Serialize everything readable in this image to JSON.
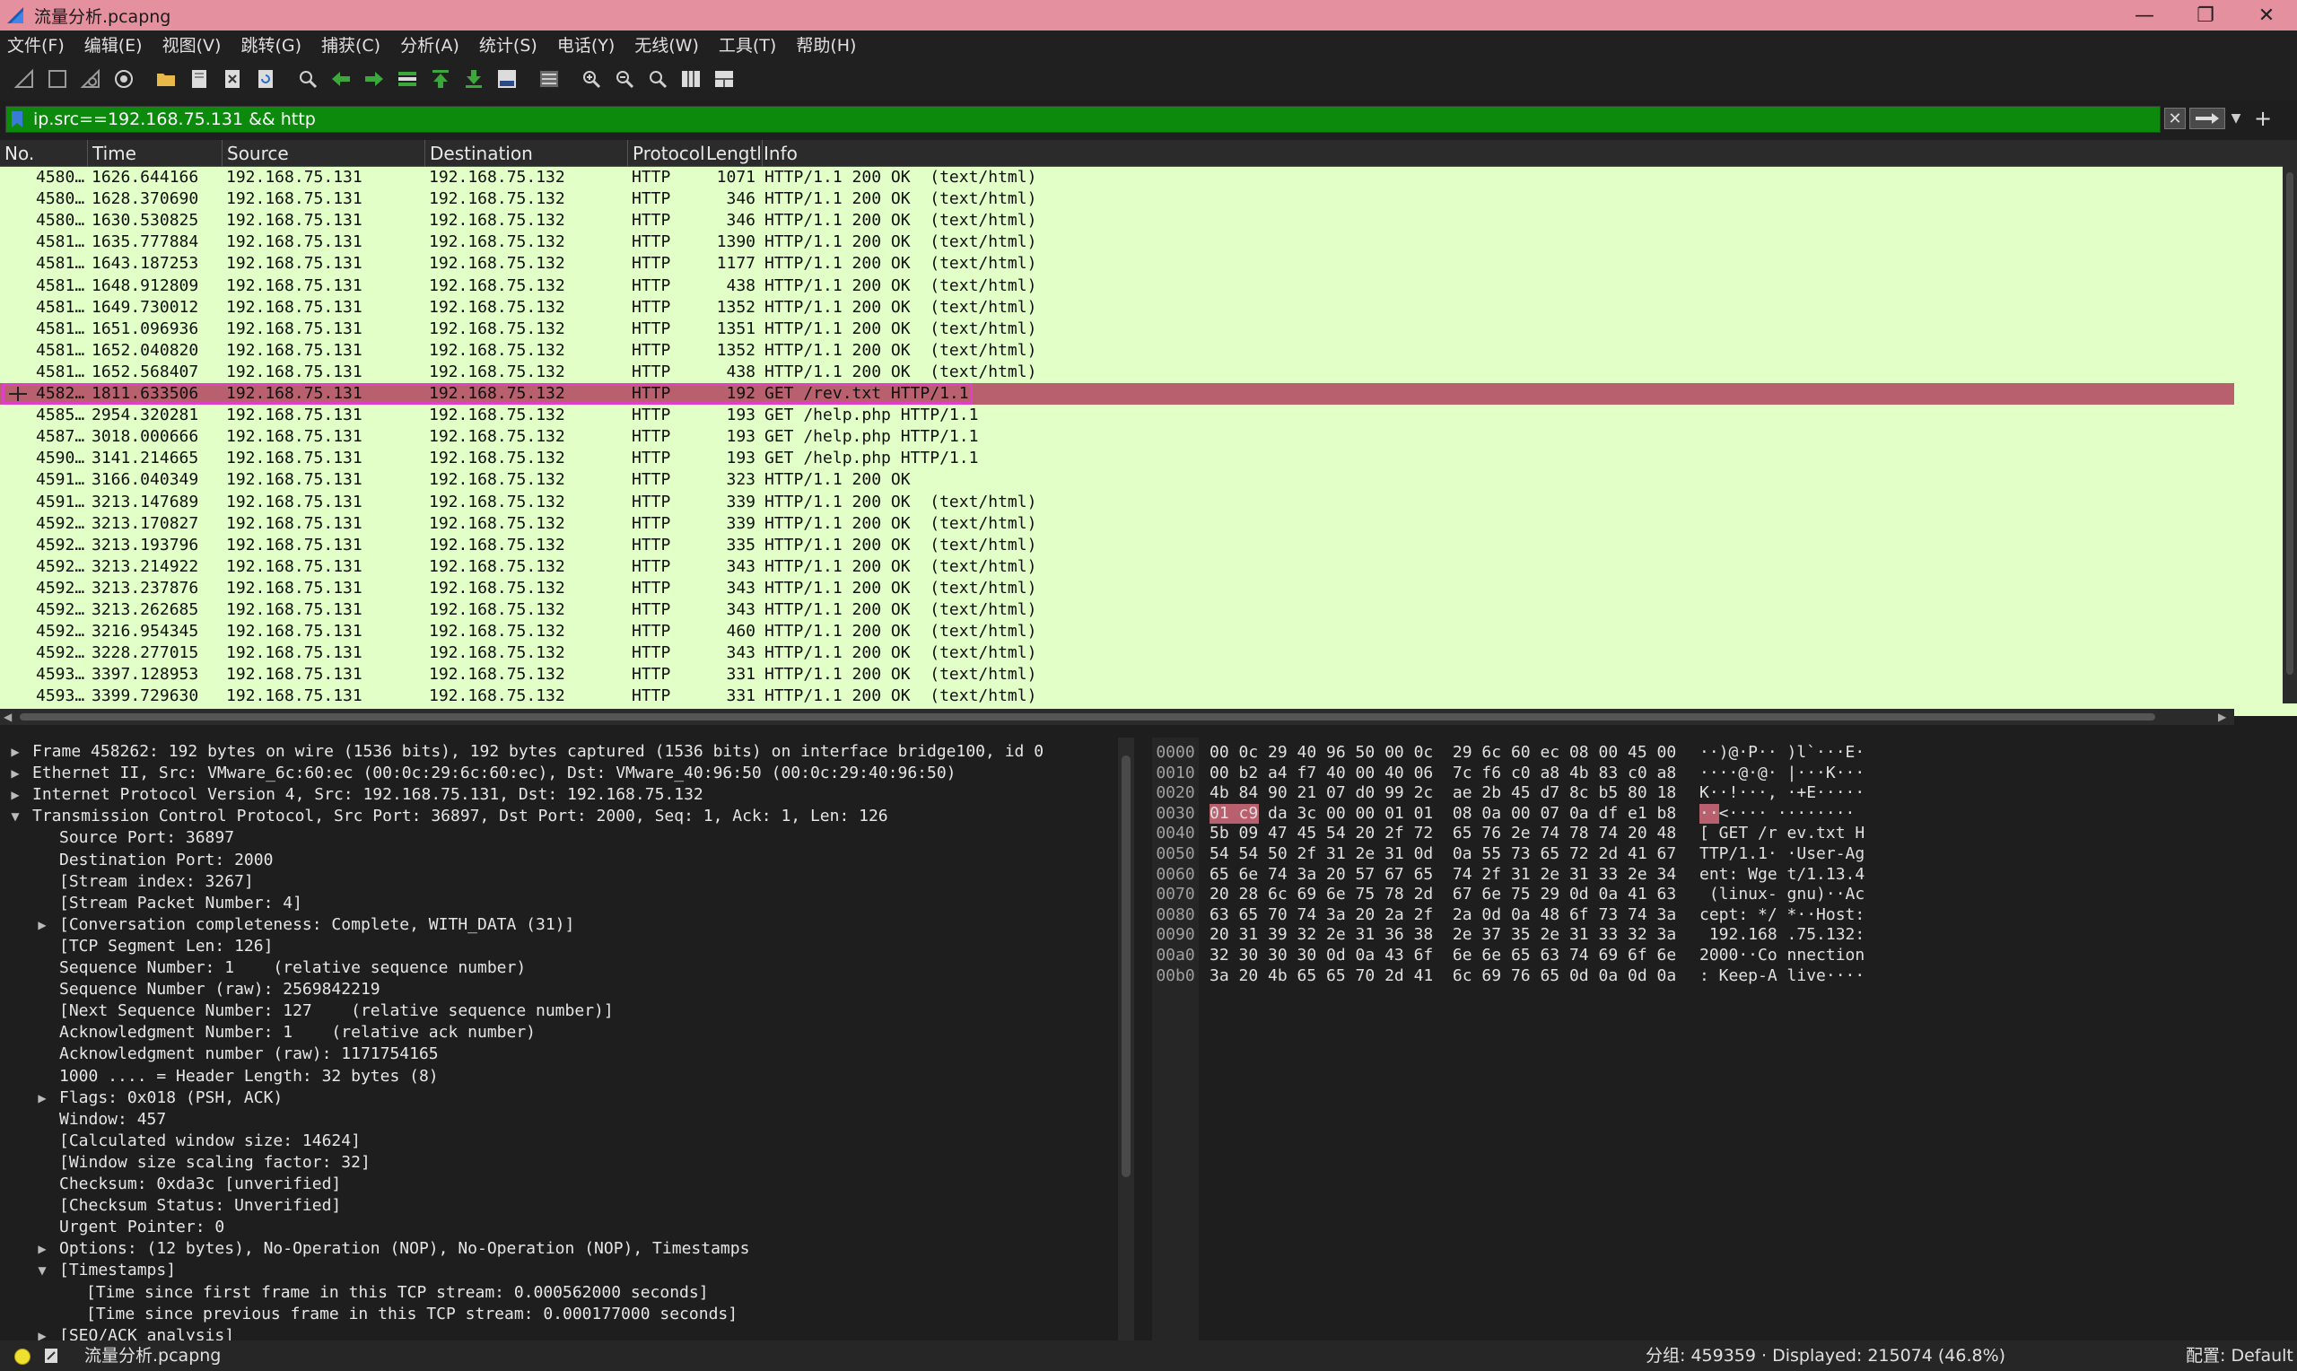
{
  "window": {
    "title": "流量分析.pcapng",
    "minimize": "—",
    "maximize": "❐",
    "close": "✕"
  },
  "menu": [
    "文件(F)",
    "编辑(E)",
    "视图(V)",
    "跳转(G)",
    "捕获(C)",
    "分析(A)",
    "统计(S)",
    "电话(Y)",
    "无线(W)",
    "工具(T)",
    "帮助(H)"
  ],
  "toolbar_icons": [
    "shark-fin-start-icon",
    "stop-capture-icon",
    "restart-capture-icon",
    "capture-options-icon",
    "open-file-icon",
    "save-file-icon",
    "close-file-icon",
    "reload-file-icon",
    "find-packet-icon",
    "go-back-icon",
    "go-forward-icon",
    "go-to-packet-icon",
    "go-first-icon",
    "go-last-icon",
    "auto-scroll-icon",
    "colorize-icon",
    "zoom-in-icon",
    "zoom-out-icon",
    "zoom-normal-icon",
    "resize-columns-icon",
    "layout-icon"
  ],
  "filter": {
    "value": "ip.src==192.168.75.131 && http",
    "background": "#0b8a0b"
  },
  "packet_list": {
    "columns": [
      "No.",
      "Time",
      "Source",
      "Destination",
      "Protocol",
      "Lengtl",
      "Info"
    ],
    "rows": [
      {
        "no": "4580…",
        "time": "1626.644166",
        "src": "192.168.75.131",
        "dst": "192.168.75.132",
        "proto": "HTTP",
        "len": "1071",
        "info": "HTTP/1.1 200 OK  (text/html)"
      },
      {
        "no": "4580…",
        "time": "1628.370690",
        "src": "192.168.75.131",
        "dst": "192.168.75.132",
        "proto": "HTTP",
        "len": "346",
        "info": "HTTP/1.1 200 OK  (text/html)"
      },
      {
        "no": "4580…",
        "time": "1630.530825",
        "src": "192.168.75.131",
        "dst": "192.168.75.132",
        "proto": "HTTP",
        "len": "346",
        "info": "HTTP/1.1 200 OK  (text/html)"
      },
      {
        "no": "4581…",
        "time": "1635.777884",
        "src": "192.168.75.131",
        "dst": "192.168.75.132",
        "proto": "HTTP",
        "len": "1390",
        "info": "HTTP/1.1 200 OK  (text/html)"
      },
      {
        "no": "4581…",
        "time": "1643.187253",
        "src": "192.168.75.131",
        "dst": "192.168.75.132",
        "proto": "HTTP",
        "len": "1177",
        "info": "HTTP/1.1 200 OK  (text/html)"
      },
      {
        "no": "4581…",
        "time": "1648.912809",
        "src": "192.168.75.131",
        "dst": "192.168.75.132",
        "proto": "HTTP",
        "len": "438",
        "info": "HTTP/1.1 200 OK  (text/html)"
      },
      {
        "no": "4581…",
        "time": "1649.730012",
        "src": "192.168.75.131",
        "dst": "192.168.75.132",
        "proto": "HTTP",
        "len": "1352",
        "info": "HTTP/1.1 200 OK  (text/html)"
      },
      {
        "no": "4581…",
        "time": "1651.096936",
        "src": "192.168.75.131",
        "dst": "192.168.75.132",
        "proto": "HTTP",
        "len": "1351",
        "info": "HTTP/1.1 200 OK  (text/html)"
      },
      {
        "no": "4581…",
        "time": "1652.040820",
        "src": "192.168.75.131",
        "dst": "192.168.75.132",
        "proto": "HTTP",
        "len": "1352",
        "info": "HTTP/1.1 200 OK  (text/html)"
      },
      {
        "no": "4581…",
        "time": "1652.568407",
        "src": "192.168.75.131",
        "dst": "192.168.75.132",
        "proto": "HTTP",
        "len": "438",
        "info": "HTTP/1.1 200 OK  (text/html)"
      },
      {
        "no": "4582…",
        "time": "1811.633506",
        "src": "192.168.75.131",
        "dst": "192.168.75.132",
        "proto": "HTTP",
        "len": "192",
        "info": "GET /rev.txt HTTP/1.1",
        "selected": true
      },
      {
        "no": "4585…",
        "time": "2954.320281",
        "src": "192.168.75.131",
        "dst": "192.168.75.132",
        "proto": "HTTP",
        "len": "193",
        "info": "GET /help.php HTTP/1.1"
      },
      {
        "no": "4587…",
        "time": "3018.000666",
        "src": "192.168.75.131",
        "dst": "192.168.75.132",
        "proto": "HTTP",
        "len": "193",
        "info": "GET /help.php HTTP/1.1"
      },
      {
        "no": "4590…",
        "time": "3141.214665",
        "src": "192.168.75.131",
        "dst": "192.168.75.132",
        "proto": "HTTP",
        "len": "193",
        "info": "GET /help.php HTTP/1.1"
      },
      {
        "no": "4591…",
        "time": "3166.040349",
        "src": "192.168.75.131",
        "dst": "192.168.75.132",
        "proto": "HTTP",
        "len": "323",
        "info": "HTTP/1.1 200 OK"
      },
      {
        "no": "4591…",
        "time": "3213.147689",
        "src": "192.168.75.131",
        "dst": "192.168.75.132",
        "proto": "HTTP",
        "len": "339",
        "info": "HTTP/1.1 200 OK  (text/html)"
      },
      {
        "no": "4592…",
        "time": "3213.170827",
        "src": "192.168.75.131",
        "dst": "192.168.75.132",
        "proto": "HTTP",
        "len": "339",
        "info": "HTTP/1.1 200 OK  (text/html)"
      },
      {
        "no": "4592…",
        "time": "3213.193796",
        "src": "192.168.75.131",
        "dst": "192.168.75.132",
        "proto": "HTTP",
        "len": "335",
        "info": "HTTP/1.1 200 OK  (text/html)"
      },
      {
        "no": "4592…",
        "time": "3213.214922",
        "src": "192.168.75.131",
        "dst": "192.168.75.132",
        "proto": "HTTP",
        "len": "343",
        "info": "HTTP/1.1 200 OK  (text/html)"
      },
      {
        "no": "4592…",
        "time": "3213.237876",
        "src": "192.168.75.131",
        "dst": "192.168.75.132",
        "proto": "HTTP",
        "len": "343",
        "info": "HTTP/1.1 200 OK  (text/html)"
      },
      {
        "no": "4592…",
        "time": "3213.262685",
        "src": "192.168.75.131",
        "dst": "192.168.75.132",
        "proto": "HTTP",
        "len": "343",
        "info": "HTTP/1.1 200 OK  (text/html)"
      },
      {
        "no": "4592…",
        "time": "3216.954345",
        "src": "192.168.75.131",
        "dst": "192.168.75.132",
        "proto": "HTTP",
        "len": "460",
        "info": "HTTP/1.1 200 OK  (text/html)"
      },
      {
        "no": "4592…",
        "time": "3228.277015",
        "src": "192.168.75.131",
        "dst": "192.168.75.132",
        "proto": "HTTP",
        "len": "343",
        "info": "HTTP/1.1 200 OK  (text/html)"
      },
      {
        "no": "4593…",
        "time": "3397.128953",
        "src": "192.168.75.131",
        "dst": "192.168.75.132",
        "proto": "HTTP",
        "len": "331",
        "info": "HTTP/1.1 200 OK  (text/html)"
      },
      {
        "no": "4593…",
        "time": "3399.729630",
        "src": "192.168.75.131",
        "dst": "192.168.75.132",
        "proto": "HTTP",
        "len": "331",
        "info": "HTTP/1.1 200 OK  (text/html)"
      }
    ],
    "row_color": "#e2ffc8",
    "selected_color": "#b8606e"
  },
  "details": [
    {
      "text": "Frame 458262: 192 bytes on wire (1536 bits), 192 bytes captured (1536 bits) on interface bridge100, id 0",
      "indent": 0,
      "arrow": "collapsed"
    },
    {
      "text": "Ethernet II, Src: VMware_6c:60:ec (00:0c:29:6c:60:ec), Dst: VMware_40:96:50 (00:0c:29:40:96:50)",
      "indent": 0,
      "arrow": "collapsed"
    },
    {
      "text": "Internet Protocol Version 4, Src: 192.168.75.131, Dst: 192.168.75.132",
      "indent": 0,
      "arrow": "collapsed"
    },
    {
      "text": "Transmission Control Protocol, Src Port: 36897, Dst Port: 2000, Seq: 1, Ack: 1, Len: 126",
      "indent": 0,
      "arrow": "expanded"
    },
    {
      "text": "Source Port: 36897",
      "indent": 1,
      "arrow": "none"
    },
    {
      "text": "Destination Port: 2000",
      "indent": 1,
      "arrow": "none"
    },
    {
      "text": "[Stream index: 3267]",
      "indent": 1,
      "arrow": "none"
    },
    {
      "text": "[Stream Packet Number: 4]",
      "indent": 1,
      "arrow": "none"
    },
    {
      "text": "[Conversation completeness: Complete, WITH_DATA (31)]",
      "indent": 1,
      "arrow": "collapsed"
    },
    {
      "text": "[TCP Segment Len: 126]",
      "indent": 1,
      "arrow": "none"
    },
    {
      "text": "Sequence Number: 1    (relative sequence number)",
      "indent": 1,
      "arrow": "none"
    },
    {
      "text": "Sequence Number (raw): 2569842219",
      "indent": 1,
      "arrow": "none"
    },
    {
      "text": "[Next Sequence Number: 127    (relative sequence number)]",
      "indent": 1,
      "arrow": "none"
    },
    {
      "text": "Acknowledgment Number: 1    (relative ack number)",
      "indent": 1,
      "arrow": "none"
    },
    {
      "text": "Acknowledgment number (raw): 1171754165",
      "indent": 1,
      "arrow": "none"
    },
    {
      "text": "1000 .... = Header Length: 32 bytes (8)",
      "indent": 1,
      "arrow": "none"
    },
    {
      "text": "Flags: 0x018 (PSH, ACK)",
      "indent": 1,
      "arrow": "collapsed"
    },
    {
      "text": "Window: 457",
      "indent": 1,
      "arrow": "none"
    },
    {
      "text": "[Calculated window size: 14624]",
      "indent": 1,
      "arrow": "none"
    },
    {
      "text": "[Window size scaling factor: 32]",
      "indent": 1,
      "arrow": "none"
    },
    {
      "text": "Checksum: 0xda3c [unverified]",
      "indent": 1,
      "arrow": "none"
    },
    {
      "text": "[Checksum Status: Unverified]",
      "indent": 1,
      "arrow": "none"
    },
    {
      "text": "Urgent Pointer: 0",
      "indent": 1,
      "arrow": "none"
    },
    {
      "text": "Options: (12 bytes), No-Operation (NOP), No-Operation (NOP), Timestamps",
      "indent": 1,
      "arrow": "collapsed"
    },
    {
      "text": "[Timestamps]",
      "indent": 1,
      "arrow": "expanded"
    },
    {
      "text": "[Time since first frame in this TCP stream: 0.000562000 seconds]",
      "indent": 2,
      "arrow": "none"
    },
    {
      "text": "[Time since previous frame in this TCP stream: 0.000177000 seconds]",
      "indent": 2,
      "arrow": "none"
    },
    {
      "text": "[SEQ/ACK analysis]",
      "indent": 1,
      "arrow": "collapsed"
    }
  ],
  "bytes": [
    {
      "offset": "0000",
      "hex": "00 0c 29 40 96 50 00 0c  29 6c 60 ec 08 00 45 00",
      "ascii": "··)@·P·· )l`···E·"
    },
    {
      "offset": "0010",
      "hex": "00 b2 a4 f7 40 00 40 06  7c f6 c0 a8 4b 83 c0 a8",
      "ascii": "····@·@· |···K···"
    },
    {
      "offset": "0020",
      "hex": "4b 84 90 21 07 d0 99 2c  ae 2b 45 d7 8c b5 80 18",
      "ascii": "K··!···, ·+E·····"
    },
    {
      "offset": "0030",
      "hex": "01 c9 da 3c 00 00 01 01  08 0a 00 07 0a df e1 b8",
      "ascii": "··<···· ········"
    },
    {
      "offset": "0040",
      "hex": "5b 09 47 45 54 20 2f 72  65 76 2e 74 78 74 20 48",
      "ascii": "[ GET /r ev.txt H"
    },
    {
      "offset": "0050",
      "hex": "54 54 50 2f 31 2e 31 0d  0a 55 73 65 72 2d 41 67",
      "ascii": "TTP/1.1· ·User-Ag"
    },
    {
      "offset": "0060",
      "hex": "65 6e 74 3a 20 57 67 65  74 2f 31 2e 31 33 2e 34",
      "ascii": "ent: Wge t/1.13.4"
    },
    {
      "offset": "0070",
      "hex": "20 28 6c 69 6e 75 78 2d  67 6e 75 29 0d 0a 41 63",
      "ascii": " (linux- gnu)··Ac"
    },
    {
      "offset": "0080",
      "hex": "63 65 70 74 3a 20 2a 2f  2a 0d 0a 48 6f 73 74 3a",
      "ascii": "cept: */ *··Host:"
    },
    {
      "offset": "0090",
      "hex": "20 31 39 32 2e 31 36 38  2e 37 35 2e 31 33 32 3a",
      "ascii": " 192.168 .75.132:"
    },
    {
      "offset": "00a0",
      "hex": "32 30 30 30 0d 0a 43 6f  6e 6e 65 63 74 69 6f 6e",
      "ascii": "2000··Co nnection"
    },
    {
      "offset": "00b0",
      "hex": "3a 20 4b 65 65 70 2d 41  6c 69 76 65 0d 0a 0d 0a",
      "ascii": ": Keep-A live····"
    }
  ],
  "status": {
    "file": "流量分析.pcapng",
    "packets": "分组: 459359 · Displayed: 215074 (46.8%)",
    "profile": "配置: Default"
  }
}
